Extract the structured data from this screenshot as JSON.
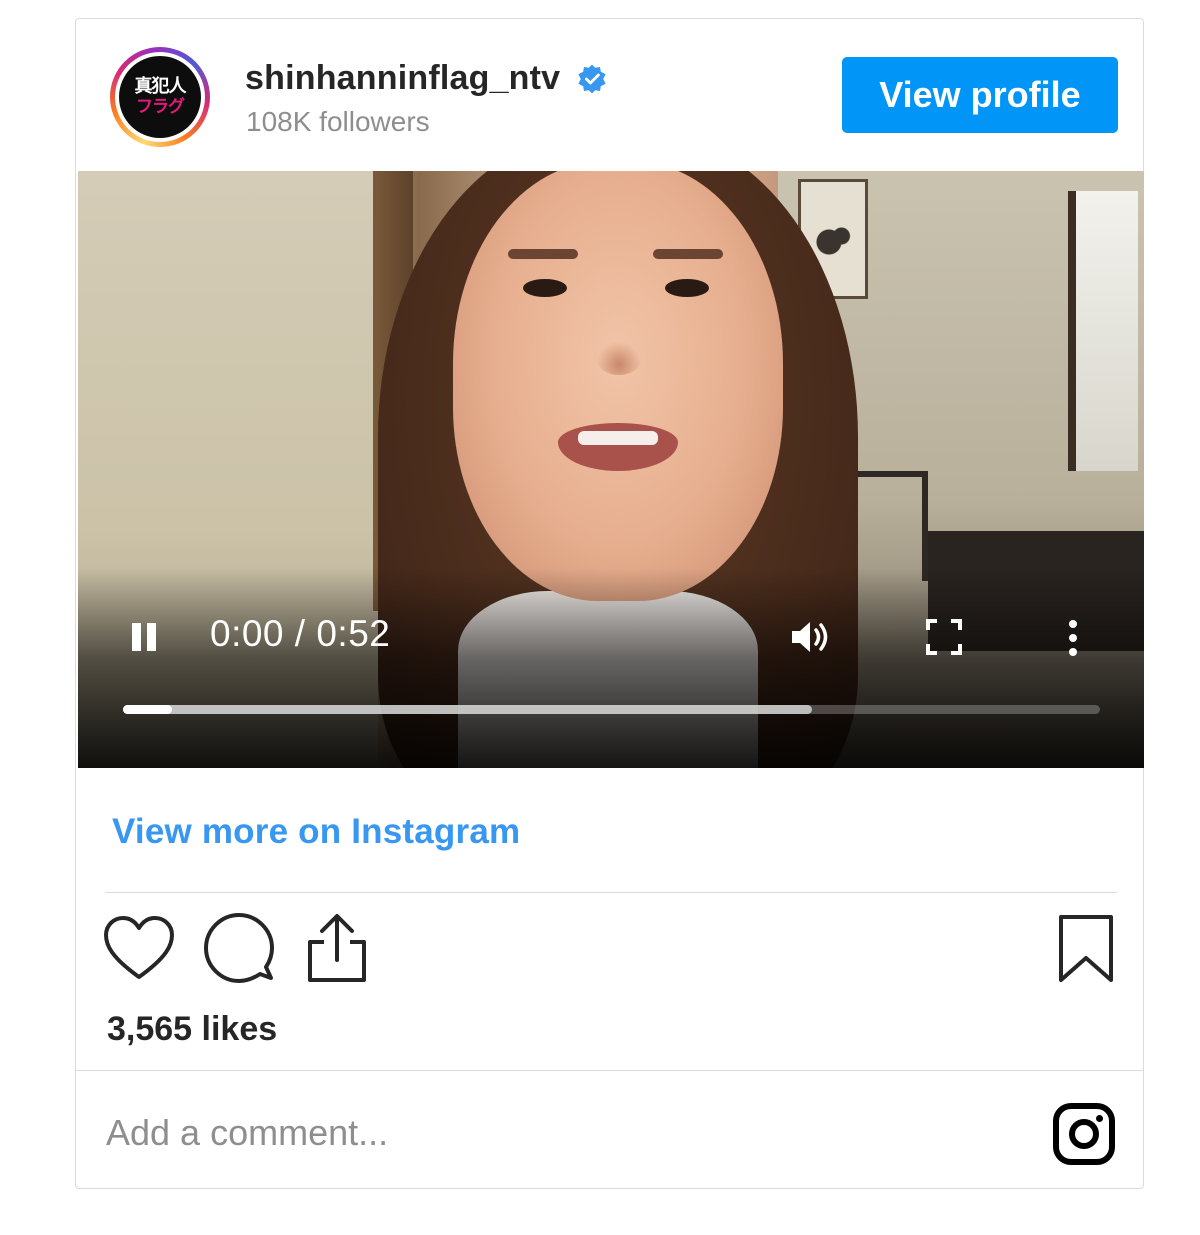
{
  "header": {
    "avatar_text_line1": "真犯人",
    "avatar_text_line2": "フラグ",
    "username": "shinhanninflag_ntv",
    "followers": "108K followers",
    "view_profile_label": "View profile"
  },
  "video": {
    "time_display": "0:00 / 0:52",
    "progress_played_fraction": 0.05,
    "progress_buffered_fraction": 0.705,
    "state": "playing"
  },
  "footer": {
    "view_more_label": "View more on Instagram",
    "likes": "3,565 likes",
    "comment_placeholder": "Add a comment..."
  },
  "colors": {
    "accent_blue": "#0095f6",
    "link_blue": "#3897f0",
    "verified_blue": "#3897f0",
    "text_dark": "#262626",
    "text_muted": "#8e8e8e",
    "border": "#dbdbdb"
  },
  "icons": {
    "verified": "verified-badge-icon",
    "pause": "pause-icon",
    "volume": "volume-icon",
    "fullscreen": "fullscreen-icon",
    "more": "more-vertical-icon",
    "like": "heart-icon",
    "comment": "comment-icon",
    "share": "share-icon",
    "save": "bookmark-icon",
    "instagram": "instagram-logo-icon"
  }
}
